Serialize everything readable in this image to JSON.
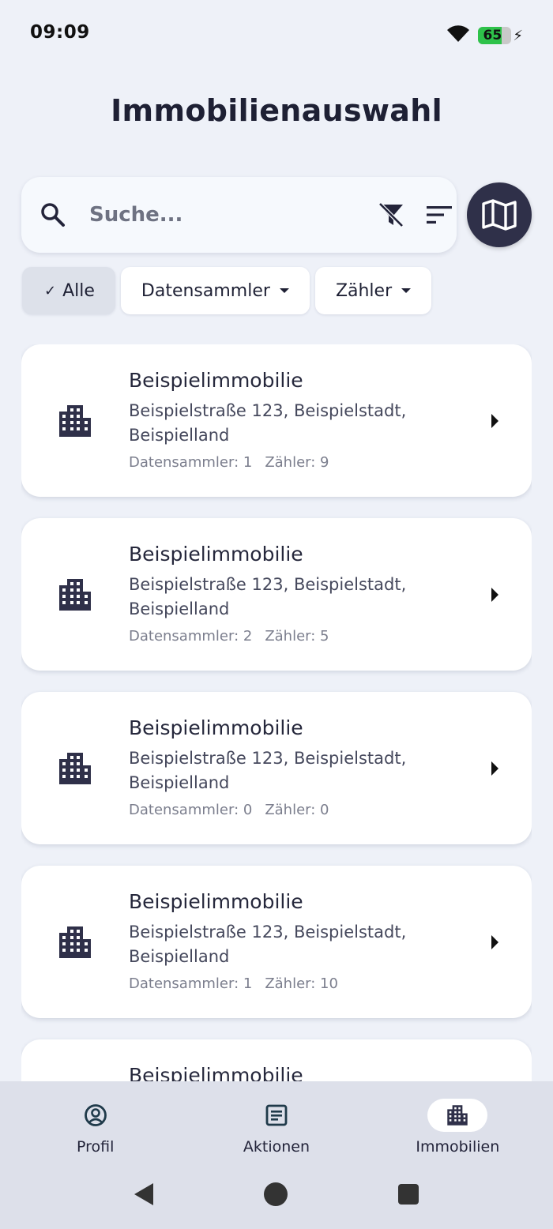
{
  "status_bar": {
    "time": "09:09",
    "battery": "65"
  },
  "page_title": "Immobilienauswahl",
  "search": {
    "placeholder": "Suche..."
  },
  "filters": {
    "all_label": "Alle",
    "collector_label": "Datensammler",
    "meter_label": "Zähler"
  },
  "properties": [
    {
      "name": "Beispielimmobilie",
      "address_line1": "Beispielstraße 123, Beispielstadt,",
      "address_line2": "Beispielland",
      "collectors": "Datensammler: 1",
      "meters": "Zähler: 9"
    },
    {
      "name": "Beispielimmobilie",
      "address_line1": "Beispielstraße 123, Beispielstadt,",
      "address_line2": "Beispielland",
      "collectors": "Datensammler: 2",
      "meters": "Zähler: 5"
    },
    {
      "name": "Beispielimmobilie",
      "address_line1": "Beispielstraße 123, Beispielstadt,",
      "address_line2": "Beispielland",
      "collectors": "Datensammler: 0",
      "meters": "Zähler: 0"
    },
    {
      "name": "Beispielimmobilie",
      "address_line1": "Beispielstraße 123, Beispielstadt,",
      "address_line2": "Beispielland",
      "collectors": "Datensammler: 1",
      "meters": "Zähler: 10"
    },
    {
      "name": "Beispielimmobilie"
    }
  ],
  "bottom_nav": {
    "profile": "Profil",
    "actions": "Aktionen",
    "properties": "Immobilien",
    "active": "properties"
  },
  "colors": {
    "background": "#eef1f8",
    "primary_dark": "#2f3049",
    "battery_green": "#2ec24a",
    "nav_background": "#dde0ea"
  }
}
